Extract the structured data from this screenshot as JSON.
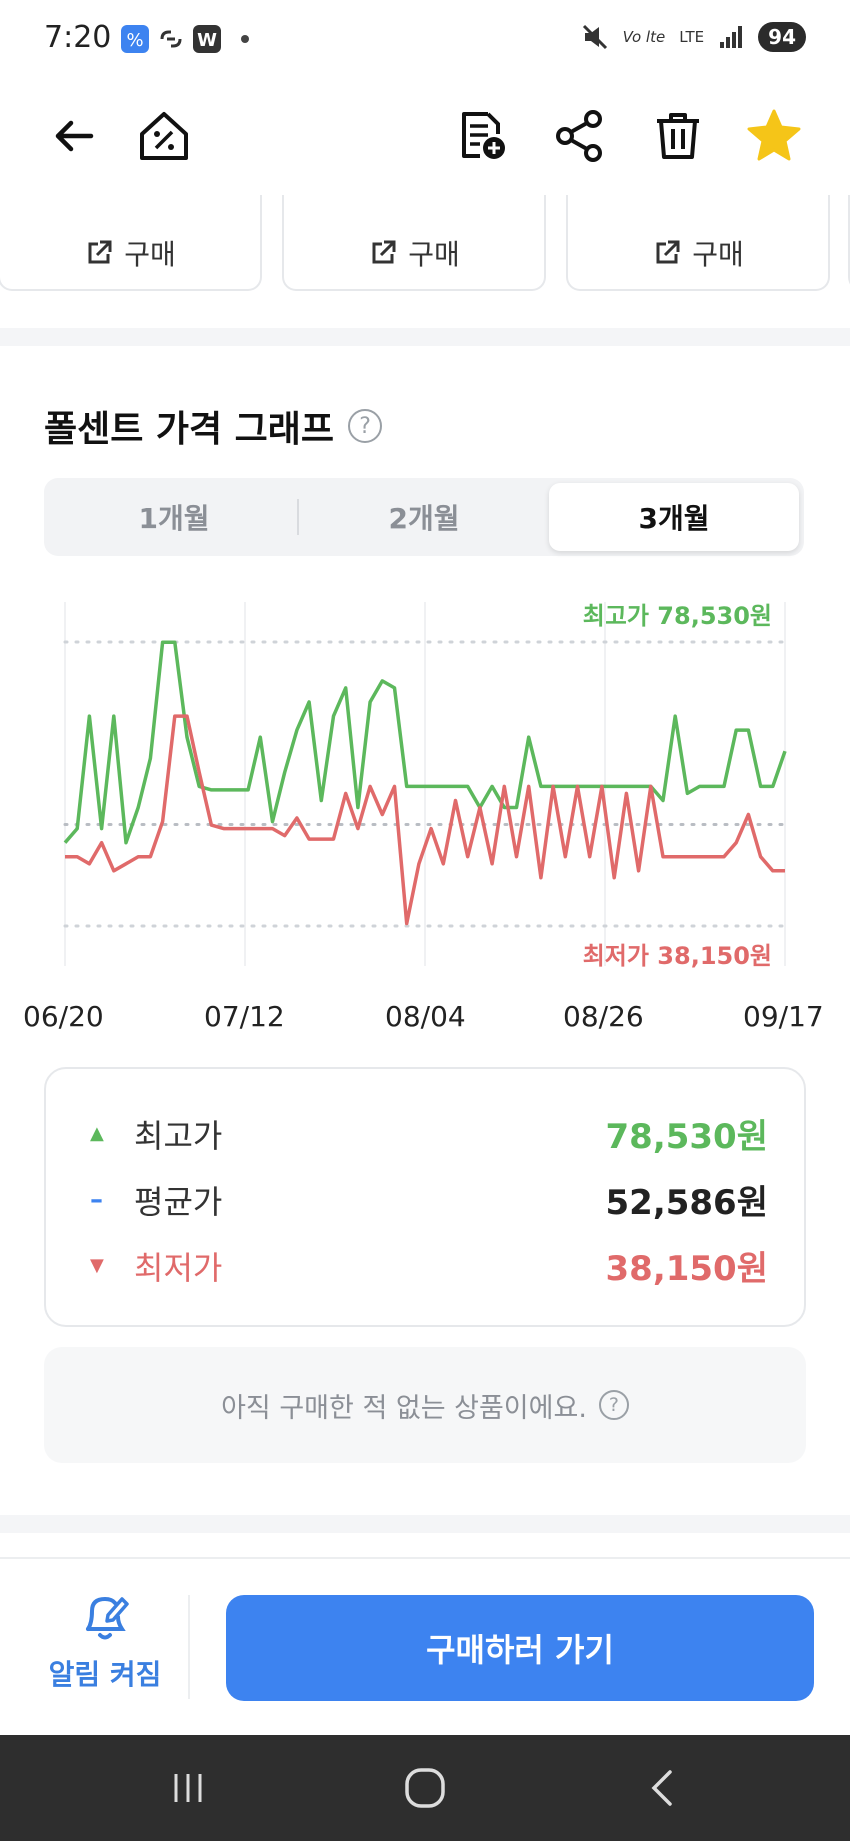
{
  "status_bar": {
    "time": "7:20",
    "battery": "94",
    "network": "LTE"
  },
  "app_bar": {
    "icons": [
      "back-arrow-icon",
      "home-percent-icon",
      "add-to-list-icon",
      "share-icon",
      "trash-icon",
      "star-icon"
    ]
  },
  "store_cards": [
    {
      "buy_label": "구매"
    },
    {
      "buy_label": "구매"
    },
    {
      "buy_label": "구매"
    }
  ],
  "graph": {
    "title": "폴센트 가격 그래프",
    "tabs": [
      "1개월",
      "2개월",
      "3개월"
    ],
    "active_tab": "3개월",
    "max_label": "최고가 78,530원",
    "min_label": "최저가 38,150원"
  },
  "chart_data": {
    "type": "line",
    "x": [
      "06/20",
      "07/12",
      "08/04",
      "08/26",
      "09/17"
    ],
    "ylim": [
      38150,
      78530
    ],
    "reference_lines": {
      "max": 78530,
      "avg": 52586,
      "min": 38150
    },
    "series": [
      {
        "color": "#5cb85c",
        "values": [
          50000,
          52000,
          68000,
          52000,
          68000,
          50000,
          55000,
          62000,
          78500,
          78500,
          65000,
          58000,
          57500,
          57500,
          57500,
          57500,
          65000,
          53000,
          60000,
          66000,
          70000,
          56000,
          68000,
          72000,
          55000,
          70000,
          73000,
          72000,
          58000,
          58000,
          58000,
          58000,
          58000,
          58000,
          55000,
          58000,
          55000,
          55000,
          65000,
          58000,
          58000,
          58000,
          58000,
          58000,
          58000,
          58000,
          58000,
          58000,
          58000,
          56000,
          68000,
          57000,
          58000,
          58000,
          58000,
          66000,
          66000,
          58000,
          58000,
          63000
        ]
      },
      {
        "color": "#e06a6a",
        "values": [
          48000,
          48000,
          47000,
          50000,
          46000,
          47000,
          48000,
          48000,
          53000,
          68000,
          68000,
          60000,
          52500,
          52000,
          52000,
          52000,
          52000,
          52000,
          51000,
          53500,
          50500,
          50500,
          50500,
          57000,
          52000,
          58000,
          54000,
          58000,
          38500,
          47000,
          52000,
          47000,
          56000,
          48000,
          55000,
          47000,
          58000,
          48000,
          58000,
          45000,
          58000,
          48000,
          58000,
          48000,
          58000,
          45000,
          57000,
          46000,
          58000,
          48000,
          48000,
          48000,
          48000,
          48000,
          48000,
          50000,
          54000,
          48000,
          46000,
          46000
        ]
      }
    ]
  },
  "summary": {
    "max_label": "최고가",
    "max_value": "78,530원",
    "avg_label": "평균가",
    "avg_value": "52,586원",
    "min_label": "최저가",
    "min_value": "38,150원"
  },
  "notice": {
    "text": "아직 구매한 적 없는 상품이에요."
  },
  "bottom_bar": {
    "alarm_label": "알림 켜짐",
    "go_buy_label": "구매하러 가기"
  },
  "colors": {
    "max": "#5cb85c",
    "min": "#e06a6a",
    "avg": "#3d83f0",
    "primary": "#3d83f0",
    "star": "#f5c518"
  }
}
